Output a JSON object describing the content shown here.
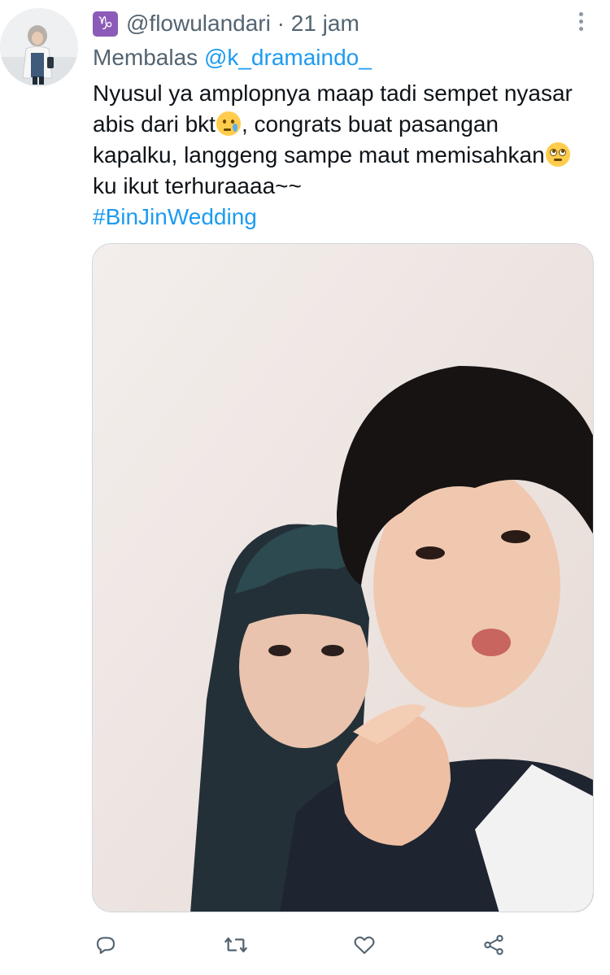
{
  "tweet": {
    "zodiac_glyph": "♑",
    "handle": "@flowulandari",
    "separator": " · ",
    "time": "21 jam",
    "reply_prefix": "Membalas ",
    "reply_handle": "@k_dramaindo_",
    "body": {
      "line1": "Nyusul ya amplopnya maap tadi sempet nyasar",
      "line2_a": "abis dari bkt",
      "line2_b": ", congrats buat pasangan",
      "line3": "kapalku, langgeng sampe maut memisahkan",
      "line4": "ku ikut terhuraaaa~~",
      "hashtag": "#BinJinWedding"
    },
    "emojis": [
      "crying-face",
      "face-with-rolling-eyes"
    ]
  },
  "actions": {
    "icons": [
      "reply-icon",
      "retweet-icon",
      "like-icon",
      "share-icon"
    ]
  },
  "colors": {
    "link": "#1d9bf0",
    "secondary_text": "#536471",
    "zodiac_badge": "#8c5ab8",
    "icon_gray": "#536471"
  }
}
